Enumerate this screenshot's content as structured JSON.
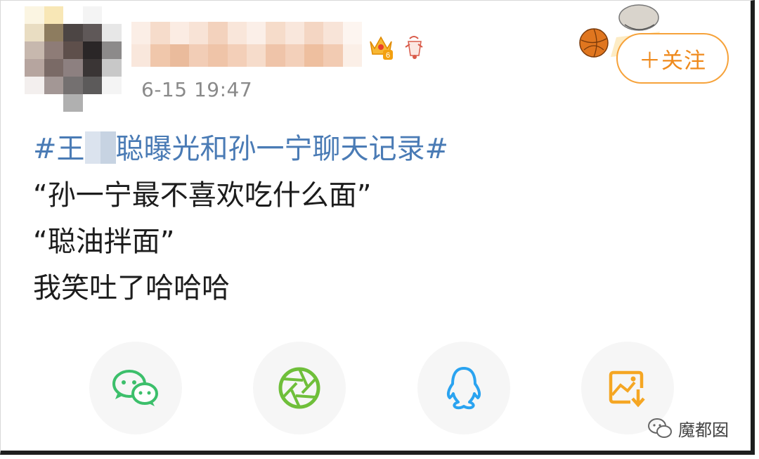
{
  "post": {
    "timestamp": "6-15 19:47",
    "follow_label": "＋关注",
    "hashtag_prefix": "#王",
    "hashtag_suffix": "聪曝光和孙一宁聊天记录#",
    "lines": [
      "“孙一宁最不喜欢吃什么面”",
      "“聪油拌面”",
      "我笑吐了哈哈哈"
    ]
  },
  "share": {
    "items": [
      {
        "name": "wechat",
        "icon": "wechat-icon",
        "color": "#3cbf6b"
      },
      {
        "name": "moments",
        "icon": "moments-aperture-icon",
        "color": "#6fbf3a"
      },
      {
        "name": "qq",
        "icon": "qq-penguin-icon",
        "color": "#2aa3f0"
      },
      {
        "name": "save-image",
        "icon": "save-image-icon",
        "color": "#f5a623"
      }
    ]
  },
  "badges": {
    "level": "6"
  },
  "watermark": {
    "text": "魔都囡"
  },
  "colors": {
    "hashtag": "#4a7bb5",
    "follow_accent": "#ef8a1c",
    "timestamp": "#8a8a8a"
  }
}
